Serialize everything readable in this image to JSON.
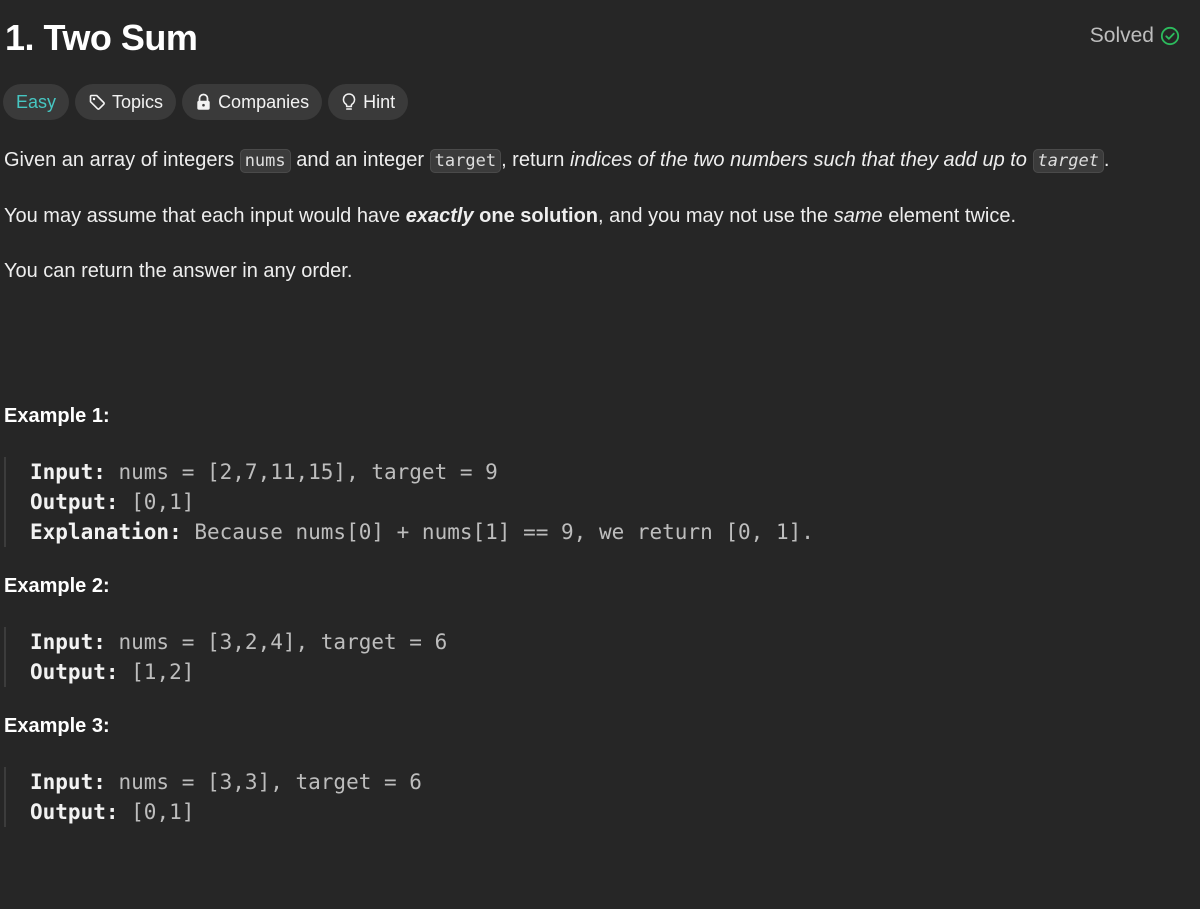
{
  "problem": {
    "title": "1. Two Sum",
    "status": "Solved",
    "status_color": "#2cbb5d"
  },
  "tags": {
    "difficulty": "Easy",
    "difficulty_color": "#46c6c2",
    "topics": "Topics",
    "companies": "Companies",
    "hint": "Hint"
  },
  "description": {
    "p1": {
      "t1": "Given an array of integers ",
      "code1": "nums",
      "t2": " and an integer ",
      "code2": "target",
      "t3": ", return ",
      "em": "indices of the two numbers such that they add up to",
      "t4": " ",
      "code3": "target",
      "t5": "."
    },
    "p2": {
      "t1": "You may assume that each input would have ",
      "strong_em": "exactly",
      "strong": " one solution",
      "t2": ", and you may not use the ",
      "em": "same",
      "t3": " element twice."
    },
    "p3": "You can return the answer in any order."
  },
  "examples": [
    {
      "title": "Example 1:",
      "input_label": "Input:",
      "input": " nums = [2,7,11,15], target = 9",
      "output_label": "Output:",
      "output": " [0,1]",
      "explanation_label": "Explanation:",
      "explanation": " Because nums[0] + nums[1] == 9, we return [0, 1]."
    },
    {
      "title": "Example 2:",
      "input_label": "Input:",
      "input": " nums = [3,2,4], target = 6",
      "output_label": "Output:",
      "output": " [1,2]"
    },
    {
      "title": "Example 3:",
      "input_label": "Input:",
      "input": " nums = [3,3], target = 6",
      "output_label": "Output:",
      "output": " [0,1]"
    }
  ],
  "icons": {
    "solved": "check-circle-icon",
    "topics": "tag-icon",
    "companies": "lock-icon",
    "hint": "lightbulb-icon"
  }
}
